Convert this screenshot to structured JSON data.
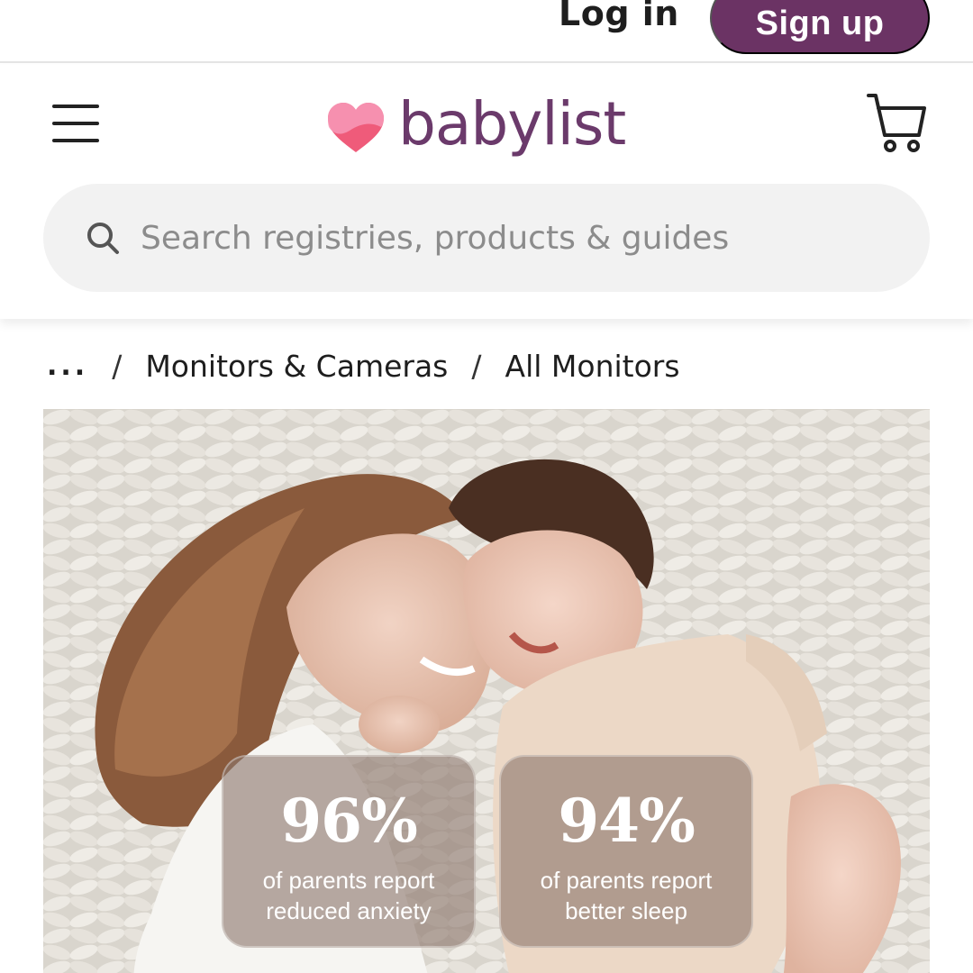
{
  "auth": {
    "login_label": "Log in",
    "signup_label": "Sign up"
  },
  "header": {
    "menu_icon": "hamburger-menu-icon",
    "logo_text": "babylist",
    "logo_icon": "heart-icon",
    "cart_icon": "cart-icon"
  },
  "search": {
    "placeholder": "Search registries, products & guides",
    "value": "",
    "icon": "search-icon"
  },
  "breadcrumb": {
    "overflow": "...",
    "separator": "/",
    "items": [
      "Monitors & Cameras",
      "All Monitors"
    ]
  },
  "hero": {
    "stats": [
      {
        "value": "96%",
        "line1": "of parents report",
        "line2": "reduced anxiety"
      },
      {
        "value": "94%",
        "line1": "of parents report",
        "line2": "better sleep"
      }
    ]
  },
  "colors": {
    "brand_purple": "#6b3364",
    "logo_text": "#6b3a6b",
    "heart_pink": "#ef5b7a",
    "heart_light": "#f7a8c0"
  }
}
